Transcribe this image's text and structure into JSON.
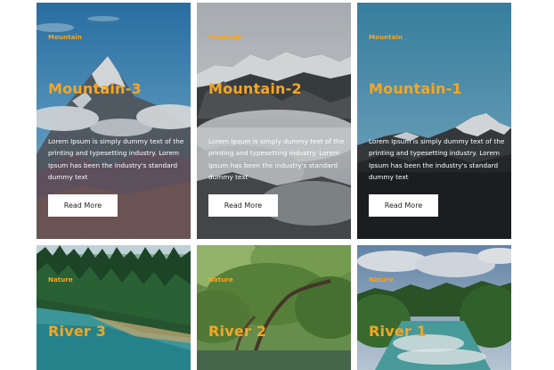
{
  "cards": [
    {
      "category": "Mountain",
      "title": "Mountain-3",
      "description": "Lorem Ipsum is simply dummy text of the printing and typesetting industry. Lorem Ipsum has been the industry's standard dummy text",
      "button_label": "Read More",
      "image": "snowy-peak-blue-sky-photo"
    },
    {
      "category": "Mountain",
      "title": "Mountain-2",
      "description": "Lorem Ipsum is simply dummy text of the printing and typesetting industry. Lorem Ipsum has been the industry's standard dummy text",
      "button_label": "Read More",
      "image": "snowy-range-fog-photo"
    },
    {
      "category": "Mountain",
      "title": "Mountain-1",
      "description": "Lorem Ipsum is simply dummy text of the printing and typesetting industry. Lorem Ipsum has been the industry's standard dummy text",
      "button_label": "Read More",
      "image": "mountain-peak-clear-sky-photo"
    },
    {
      "category": "Nature",
      "title": "River 3",
      "image": "forest-river-photo"
    },
    {
      "category": "Nature",
      "title": "River 2",
      "image": "green-trees-river-photo"
    },
    {
      "category": "Nature",
      "title": "River 1",
      "image": "rapids-river-photo"
    }
  ],
  "colors": {
    "accent": "#f5a623",
    "text_light": "#ffffff",
    "button_bg": "#ffffff"
  }
}
